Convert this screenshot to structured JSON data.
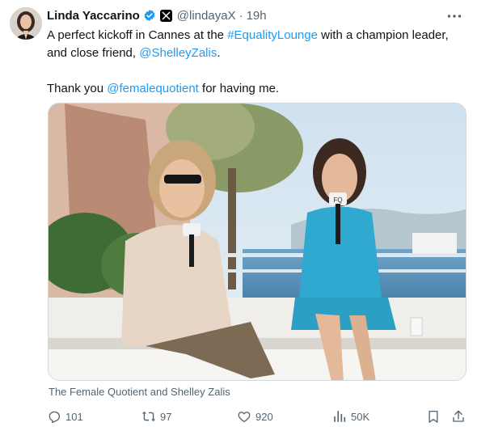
{
  "author": {
    "name": "Linda Yaccarino",
    "handle": "@lindayaX",
    "separator": "·",
    "time": "19h"
  },
  "tweet": {
    "line1_pre": "A perfect kickoff in Cannes at the ",
    "hashtag": "#EqualityLounge",
    "line1_post": " with a champion leader,",
    "line2_pre": "and close friend, ",
    "mention1": "@ShelleyZalis",
    "line2_post": ".",
    "line3_pre": "Thank you ",
    "mention2": "@femalequotient",
    "line3_post": " for having me."
  },
  "media": {
    "caption": "The Female Quotient and Shelley Zalis",
    "mic_flag_text": "FQ"
  },
  "actions": {
    "replies": "101",
    "reposts": "97",
    "likes": "920",
    "views": "50K"
  },
  "colors": {
    "link": "#1d9bf0",
    "secondary_text": "#536471",
    "verified": "#1d9bf0"
  },
  "icons": [
    "more-icon",
    "verified-icon",
    "x-affiliate-icon",
    "reply-icon",
    "repost-icon",
    "like-icon",
    "views-icon",
    "bookmark-icon",
    "share-icon"
  ]
}
